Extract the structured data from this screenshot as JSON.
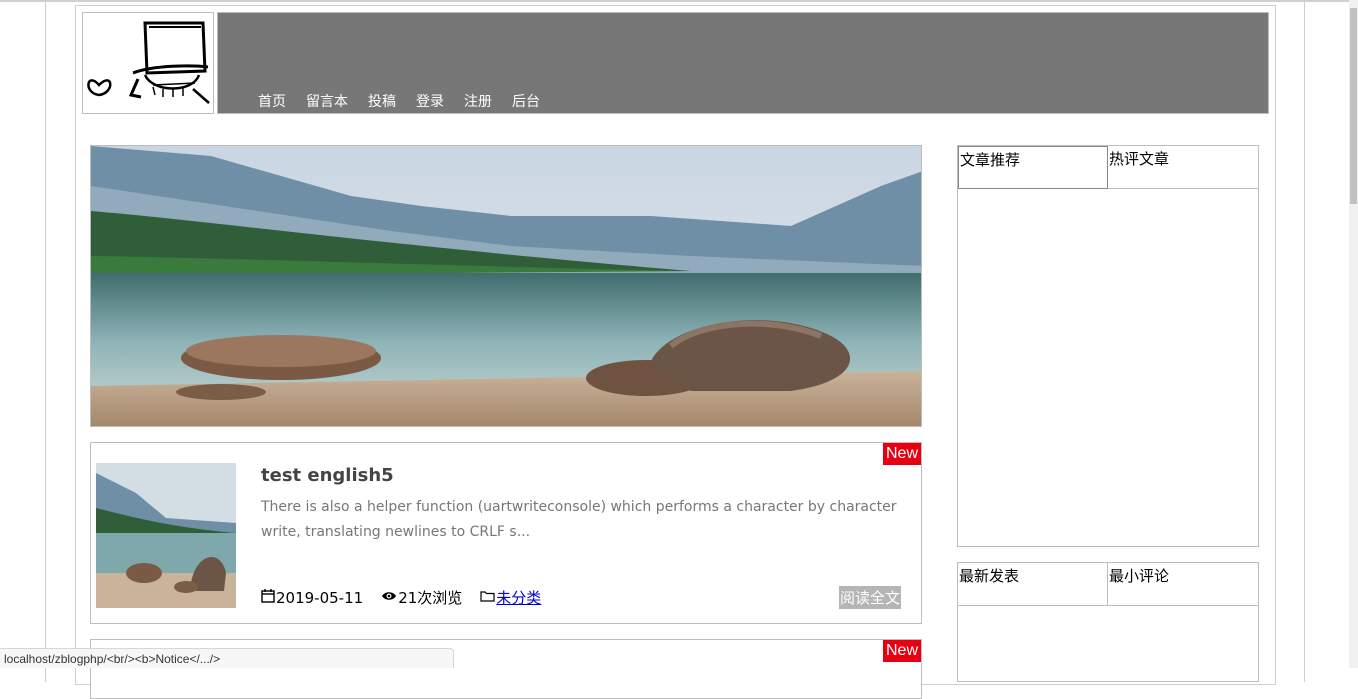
{
  "nav": {
    "items": [
      "首页",
      "留言本",
      "投稿",
      "登录",
      "注册",
      "后台"
    ]
  },
  "posts": [
    {
      "badge": "New",
      "title": "test english5",
      "excerpt": "There is also a helper function (uartwriteconsole) which performs a character by character write, translating newlines to CRLF s...",
      "date": "2019-05-11",
      "views": "21次浏览",
      "category": "未分类",
      "read_more": "阅读全文"
    },
    {
      "badge": "New"
    }
  ],
  "sidebar": {
    "widget1_tabs": [
      "文章推荐",
      "热评文章"
    ],
    "widget2_tabs": [
      "最新发表",
      "最小评论"
    ]
  },
  "status_bar": "localhost/zblogphp/<br/><b>Notice</.../>",
  "colors": {
    "header_bg": "#777777",
    "badge_bg": "#e60012",
    "read_more_bg": "#b5b5b5",
    "link": "#0000cc"
  },
  "icons": [
    "calendar-icon",
    "eye-icon",
    "folder-icon"
  ]
}
